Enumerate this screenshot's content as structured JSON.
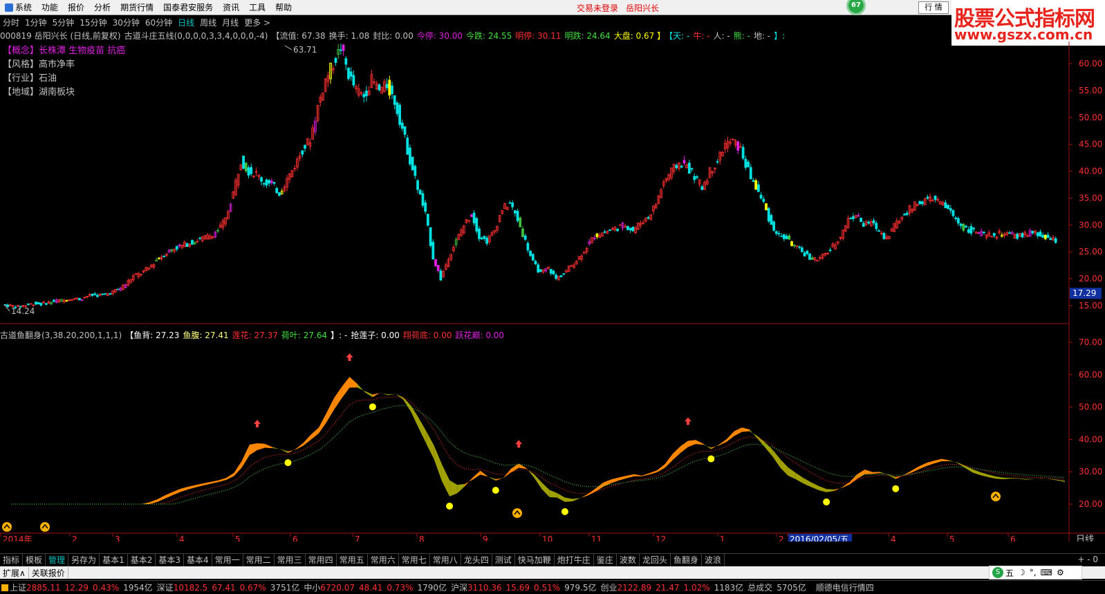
{
  "menubar": {
    "items": [
      "系统",
      "功能",
      "报价",
      "分析",
      "期货行情",
      "国泰君安服务",
      "资讯",
      "工具",
      "帮助"
    ],
    "status_login": "交易未登录",
    "status_stock": "岳阳兴长",
    "badge": "67",
    "quote_button": "行 情"
  },
  "watermark": {
    "line1": "股票公式指标网",
    "line2": "www.gszx.com.cn"
  },
  "periods": [
    "分时",
    "1分钟",
    "5分钟",
    "15分钟",
    "30分钟",
    "60分钟",
    "日线",
    "周线",
    "月线",
    "更多 >"
  ],
  "active_period": "日线",
  "info": {
    "code_name": "000819 岳阳兴长 (日线,前复权)",
    "formula": "古道斗庄五线(0,0,0,0,3,3,4,0,0,0,-4)",
    "liutong": "【流值: 67.38",
    "huanshou": "换手: 1.08",
    "fengbi": "封比: 0.00",
    "jinting": "今停: 30.00",
    "jindie": "今跌: 24.55",
    "mingting": "明停: 30.11",
    "mingdie": "明跌: 24.64",
    "dapan": "大盘: 0.67 】",
    "tian": "【天: -",
    "niu": "牛: -",
    "ren": "人: -",
    "xiong": "熊: -",
    "di": "地: -",
    "end": "】:"
  },
  "tags": [
    "【概念】长株潭 生物疫苗 抗癌",
    "【风格】高市净率",
    "【行业】石油",
    "【地域】湖南板块"
  ],
  "price_axis": [
    "60.00",
    "55.00",
    "50.00",
    "45.00",
    "40.00",
    "35.00",
    "30.00",
    "25.00",
    "20.00",
    "15.00"
  ],
  "price_current": "17.29",
  "price_high_label": "63.71",
  "price_low_label": "14.24",
  "indicator": {
    "name": "古道鱼翻身(3,38.20,200,1,1,1)",
    "yubei": "【鱼背: 27.23",
    "yufu": "鱼腹: 27.41",
    "lianhua": "莲花: 27.37",
    "heye": "荷叶: 27.64",
    "close": "】: -",
    "qianglianzi": "抢莲子: 0.00",
    "xianghedi": "翔荷底: 0.00",
    "yaohuadian": "跃花巅: 0.00"
  },
  "indicator_axis": [
    "70.00",
    "60.00",
    "50.00",
    "40.00",
    "30.00",
    "20.00"
  ],
  "time_axis": [
    "2014年",
    "2",
    "3",
    "4",
    "5",
    "6",
    "7",
    "8",
    "9",
    "10",
    "11",
    "12",
    "1",
    "2",
    "2016/02/05/五",
    "4",
    "5",
    "6"
  ],
  "time_axis_right": "日线",
  "tabs": [
    "指标",
    "模板",
    "管理",
    "另存为",
    "基本1",
    "基本2",
    "基本3",
    "基本4",
    "常用一",
    "常用二",
    "常用三",
    "常用四",
    "常用五",
    "常用六",
    "常用七",
    "常用八",
    "龙头四",
    "测试",
    "快马加鞭",
    "炮打牛庄",
    "鉴庄",
    "波数",
    "龙回头",
    "鱼翻身",
    "波浪"
  ],
  "active_tab": "管理",
  "subtabs": [
    "扩展∧",
    "关联报价"
  ],
  "ime": {
    "label": "五"
  },
  "ticker": {
    "sh_name": "上证",
    "sh_val": "2885.11",
    "sh_chg": "12.29",
    "sh_pct": "0.43%",
    "sh_vol": "1954亿",
    "sz_name": "深证",
    "sz_val": "10182.5",
    "sz_chg": "67.41",
    "sz_pct": "0.67%",
    "sz_vol": "3751亿",
    "zx_name": "中小",
    "zx_val": "6720.07",
    "zx_chg": "48.41",
    "zx_pct": "0.73%",
    "zx_vol": "1790亿",
    "hs_name": "沪深",
    "hs_val": "3110.36",
    "hs_chg": "15.69",
    "hs_pct": "0.51%",
    "hs_vol": "979.5亿",
    "cy_name": "创业",
    "cy_val": "2122.89",
    "cy_chg": "21.47",
    "cy_pct": "1.02%",
    "cy_vol": "1183亿",
    "total_label": "总成交",
    "total_val": "5705亿",
    "feed": "顺德电信行情四"
  },
  "colors": {
    "up": "#ff3030",
    "down": "#00e0e0",
    "pink": "#e020e0",
    "yellow": "#ffff00",
    "green": "#40c040",
    "orange": "#ff8800",
    "olive": "#a0a000"
  },
  "chart_data": {
    "type": "candlestick",
    "price_path": [
      15.2,
      15.0,
      14.8,
      15.1,
      15.4,
      15.3,
      15.6,
      15.9,
      16.0,
      16.4,
      16.2,
      16.8,
      17.0,
      16.9,
      17.4,
      18.0,
      19.0,
      20.5,
      21.0,
      22.0,
      23.5,
      24.5,
      25.5,
      26.0,
      26.5,
      27.0,
      27.5,
      28.0,
      29.0,
      31.0,
      36.0,
      42.0,
      40.0,
      39.5,
      38.0,
      37.5,
      36.0,
      38.5,
      41.0,
      44.0,
      46.0,
      52.0,
      57.0,
      60.0,
      63.0,
      58.0,
      55.0,
      54.0,
      57.0,
      55.0,
      56.0,
      53.0,
      48.0,
      42.0,
      37.0,
      32.0,
      24.0,
      20.0,
      24.0,
      27.0,
      30.0,
      32.0,
      28.0,
      27.0,
      29.0,
      33.0,
      34.0,
      31.0,
      27.0,
      23.0,
      21.0,
      22.0,
      20.0,
      21.0,
      22.5,
      24.0,
      26.0,
      28.0,
      28.5,
      29.0,
      29.5,
      30.0,
      29.0,
      30.5,
      31.5,
      34.0,
      38.0,
      40.0,
      41.5,
      41.0,
      39.0,
      37.0,
      40.0,
      42.0,
      45.0,
      45.5,
      44.0,
      40.0,
      37.0,
      34.0,
      30.0,
      28.0,
      27.5,
      26.0,
      25.0,
      24.0,
      23.5,
      24.5,
      26.0,
      28.0,
      31.0,
      32.0,
      30.0,
      30.5,
      29.0,
      27.5,
      30.0,
      31.5,
      33.0,
      34.0,
      34.5,
      35.0,
      34.0,
      33.0,
      31.0,
      29.5,
      29.0,
      28.5,
      28.0,
      28.0,
      28.5,
      28.2,
      27.8,
      28.3,
      28.5,
      28.0,
      27.5,
      27.0
    ]
  }
}
